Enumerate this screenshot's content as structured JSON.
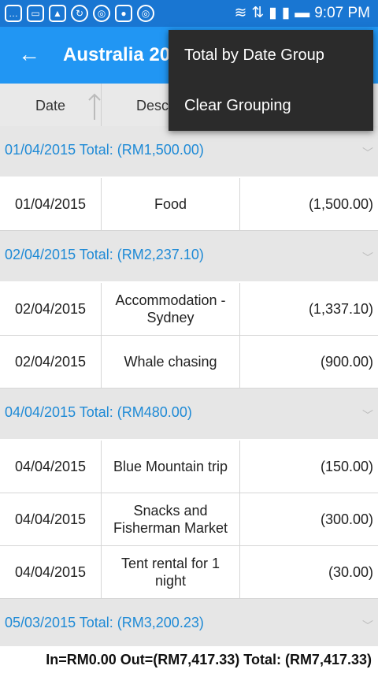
{
  "status_bar": {
    "time": "9:07 PM",
    "left_icons": [
      "chat-icon",
      "screen-icon",
      "image-icon",
      "sync-icon",
      "chrome-icon",
      "shield-icon",
      "chrome-icon"
    ],
    "right_icons": [
      "wifi-icon",
      "transfer-icon",
      "signal-1-icon",
      "signal-2-icon",
      "battery-icon"
    ]
  },
  "app_bar": {
    "title": "Australia 20",
    "back_icon": "arrow-left-icon"
  },
  "columns": {
    "date": "Date",
    "description": "Desc"
  },
  "groups": [
    {
      "label": "01/04/2015 Total: (RM1,500.00)",
      "rows": [
        {
          "date": "01/04/2015",
          "description": "Food",
          "amount": "(1,500.00)"
        }
      ]
    },
    {
      "label": "02/04/2015 Total: (RM2,237.10)",
      "rows": [
        {
          "date": "02/04/2015",
          "description": "Accommodation - Sydney",
          "amount": "(1,337.10)"
        },
        {
          "date": "02/04/2015",
          "description": "Whale chasing",
          "amount": "(900.00)"
        }
      ]
    },
    {
      "label": "04/04/2015 Total: (RM480.00)",
      "rows": [
        {
          "date": "04/04/2015",
          "description": "Blue Mountain trip",
          "amount": "(150.00)"
        },
        {
          "date": "04/04/2015",
          "description": "Snacks and Fisherman Market",
          "amount": "(300.00)"
        },
        {
          "date": "04/04/2015",
          "description": "Tent rental for 1 night",
          "amount": "(30.00)"
        }
      ]
    },
    {
      "label": "05/03/2015 Total: (RM3,200.23)",
      "rows": []
    }
  ],
  "footer": {
    "summary": "In=RM0.00 Out=(RM7,417.33) Total: (RM7,417.33)"
  },
  "menu": {
    "items": [
      "Total by Date Group",
      "Clear Grouping"
    ]
  },
  "colors": {
    "status_bar": "#1976D2",
    "app_bar": "#2196F3",
    "group_label": "#1e8ad6",
    "menu_bg": "#2b2b2b"
  }
}
